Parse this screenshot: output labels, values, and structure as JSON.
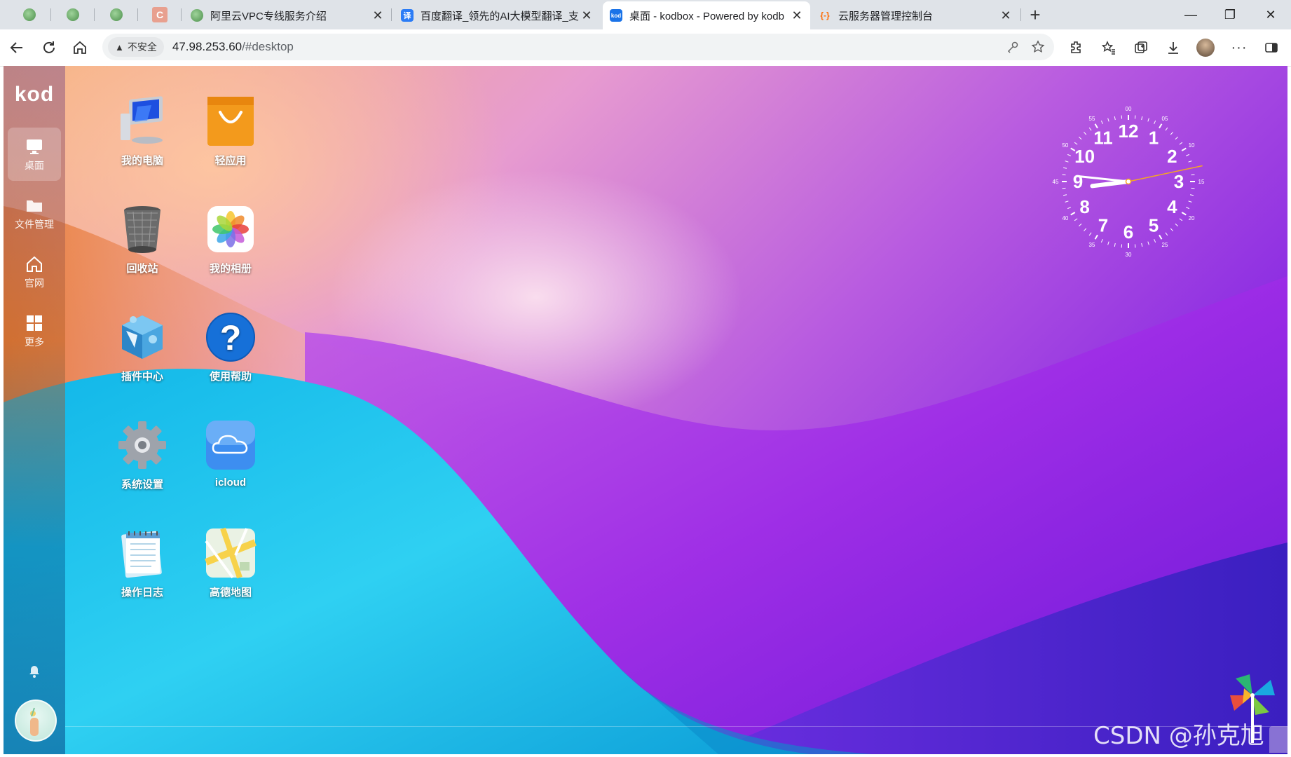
{
  "browser": {
    "pinned_tabs": [
      {
        "icon": "leaf-favicon-icon"
      },
      {
        "icon": "leaf-favicon-icon"
      },
      {
        "icon": "leaf-favicon-icon"
      },
      {
        "icon": "c-favicon-icon"
      }
    ],
    "tabs": [
      {
        "label": "阿里云VPC专线服务介绍",
        "favicon": "leaf-favicon-icon",
        "active": false
      },
      {
        "label": "百度翻译_领先的AI大模型翻译_支",
        "favicon": "translate-favicon-icon",
        "favicon_text": "译",
        "active": false
      },
      {
        "label": "桌面 - kodbox - Powered by kodb",
        "favicon": "kod-favicon-icon",
        "favicon_text": "kod",
        "active": true
      },
      {
        "label": "云服务器管理控制台",
        "favicon": "aliyun-favicon-icon",
        "favicon_text": "{-}",
        "active": false
      }
    ],
    "address": {
      "security_label": "不安全",
      "url_host": "47.98.253.60",
      "url_path": "/#desktop"
    }
  },
  "app": {
    "logo": "kod",
    "nav": [
      {
        "label": "桌面",
        "icon": "monitor-icon",
        "active": true
      },
      {
        "label": "文件管理",
        "icon": "folder-icon",
        "active": false
      },
      {
        "label": "官网",
        "icon": "home-icon",
        "active": false
      },
      {
        "label": "更多",
        "icon": "grid-icon",
        "active": false
      }
    ],
    "desktop_icons": [
      {
        "label": "我的电脑",
        "icon": "computer-icon"
      },
      {
        "label": "轻应用",
        "icon": "shopping-bag-icon"
      },
      {
        "label": "回收站",
        "icon": "trash-bin-icon"
      },
      {
        "label": "我的相册",
        "icon": "photos-icon"
      },
      {
        "label": "插件中心",
        "icon": "plugin-cube-icon"
      },
      {
        "label": "使用帮助",
        "icon": "help-icon"
      },
      {
        "label": "系统设置",
        "icon": "gear-icon"
      },
      {
        "label": "icloud",
        "icon": "cloud-icon"
      },
      {
        "label": "操作日志",
        "icon": "notepad-icon"
      },
      {
        "label": "高德地图",
        "icon": "map-icon"
      }
    ],
    "clock": {
      "hours": [
        "12",
        "1",
        "2",
        "3",
        "4",
        "5",
        "6",
        "7",
        "8",
        "9",
        "10",
        "11"
      ],
      "minutes": [
        "00",
        "05",
        "10",
        "15",
        "20",
        "25",
        "30",
        "35",
        "40",
        "45",
        "50",
        "55"
      ],
      "time": {
        "hour": 8,
        "minute": 46,
        "second": 15
      }
    },
    "watermark": "CSDN @孙克旭"
  },
  "colors": {
    "accent_blue": "#1a73e8",
    "tab_strip": "#dfe3e8",
    "second_hand": "#f5a623"
  }
}
